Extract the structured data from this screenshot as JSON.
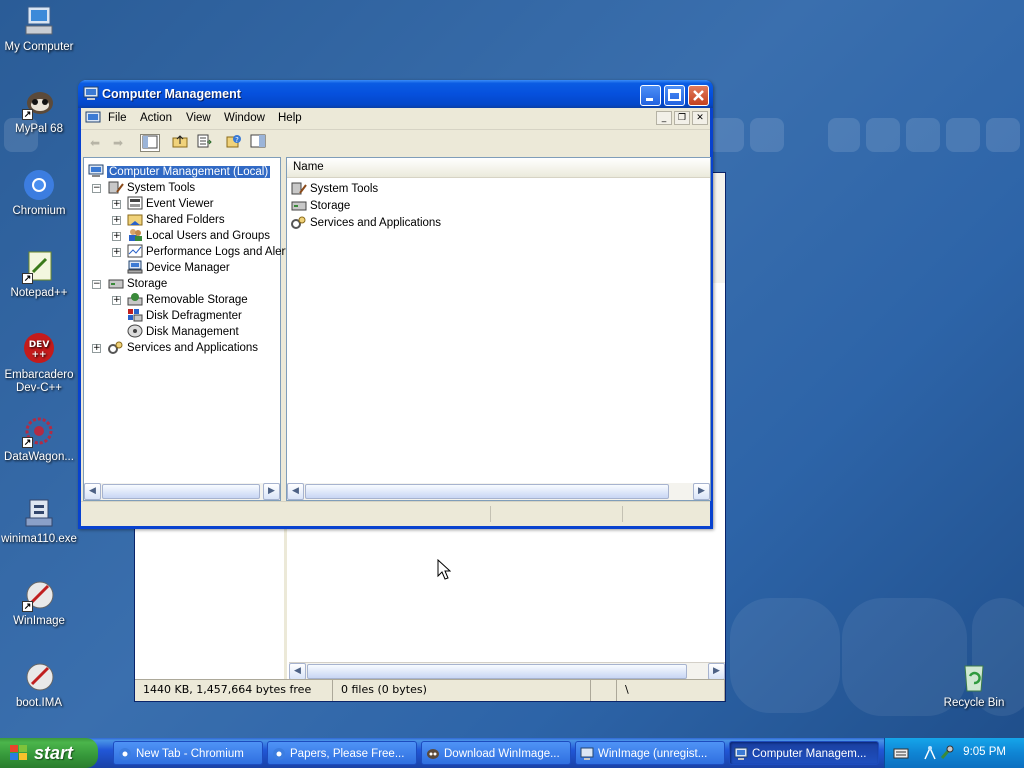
{
  "desktop": {
    "icons": [
      {
        "label": "My Computer"
      },
      {
        "label": "MyPal 68"
      },
      {
        "label": "Chromium"
      },
      {
        "label": "Notepad++"
      },
      {
        "label": "Embarcadero Dev-C++"
      },
      {
        "label": "DataWagon..."
      },
      {
        "label": "winima110.exe"
      },
      {
        "label": "WinImage"
      },
      {
        "label": "boot.IMA"
      },
      {
        "label": "Recycle Bin"
      }
    ]
  },
  "background_window": {
    "status_free": "1440 KB, 1,457,664 bytes free",
    "status_files": "0 files (0 bytes)",
    "status_path": "\\"
  },
  "window": {
    "title": "Computer Management",
    "menu": [
      "File",
      "Action",
      "View",
      "Window",
      "Help"
    ],
    "tree": [
      {
        "label": "Computer Management (Local)"
      },
      {
        "label": "System Tools"
      },
      {
        "label": "Event Viewer"
      },
      {
        "label": "Shared Folders"
      },
      {
        "label": "Local Users and Groups"
      },
      {
        "label": "Performance Logs and Alerts"
      },
      {
        "label": "Device Manager"
      },
      {
        "label": "Storage"
      },
      {
        "label": "Removable Storage"
      },
      {
        "label": "Disk Defragmenter"
      },
      {
        "label": "Disk Management"
      },
      {
        "label": "Services and Applications"
      }
    ],
    "list_header": "Name",
    "list_items": [
      "System Tools",
      "Storage",
      "Services and Applications"
    ]
  },
  "taskbar": {
    "start_label": "start",
    "tasks": [
      {
        "label": "New Tab - Chromium"
      },
      {
        "label": "Papers, Please Free..."
      },
      {
        "label": "Download WinImage..."
      },
      {
        "label": "WinImage (unregist..."
      },
      {
        "label": "Computer Managem..."
      }
    ],
    "clock": "9:05 PM"
  },
  "colors": {
    "titlebar": "#0a5ce3",
    "selection": "#316ac5",
    "start_green": "#35973a",
    "desktop_blue": "#2d64a8"
  }
}
